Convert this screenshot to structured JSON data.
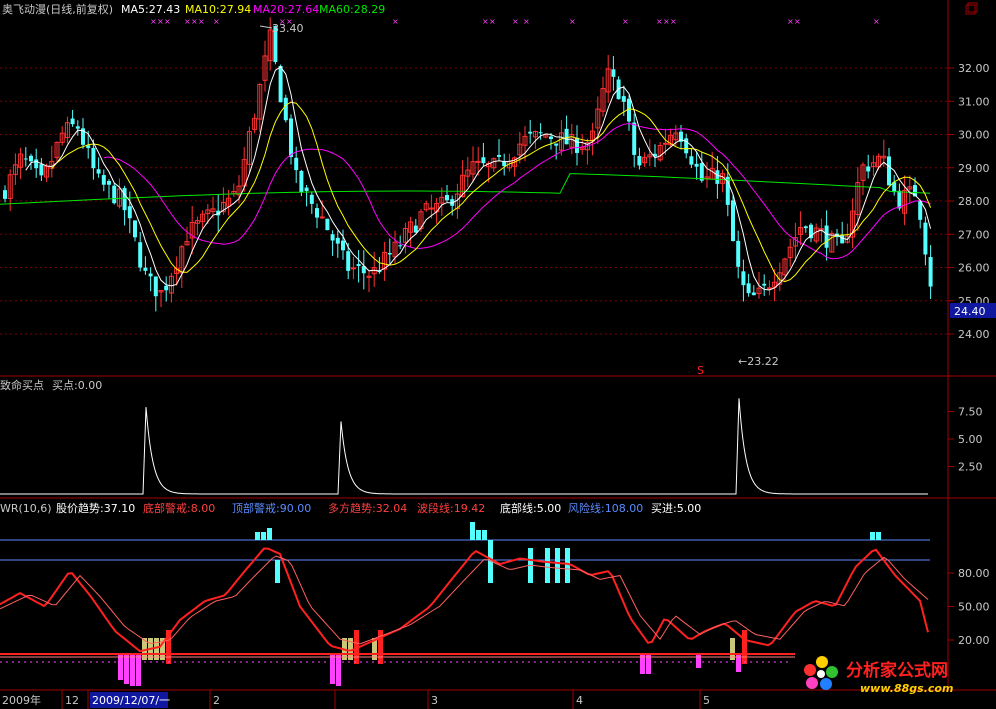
{
  "main_legend": {
    "stock": "奥飞动漫(日线,前复权)",
    "ma5": "MA5:27.43",
    "ma10": "MA10:27.94",
    "ma20": "MA20:27.64",
    "ma60": "MA60:28.29"
  },
  "main_axis": {
    "ticks": [
      "32.00",
      "31.00",
      "30.00",
      "29.00",
      "28.00",
      "27.00",
      "26.00",
      "25.00",
      "24.00"
    ],
    "tick_values": [
      32,
      31,
      30,
      29,
      28,
      27,
      26,
      25,
      24
    ],
    "current_price": "24.40",
    "high_label": "33.40",
    "low_label": "←23.22",
    "marker": "S"
  },
  "sub1_legend": {
    "title": "致命买点",
    "buy": "买点:0.00"
  },
  "sub1_axis": {
    "ticks": [
      "7.50",
      "5.00",
      "2.50"
    ],
    "tick_values": [
      7.5,
      5,
      2.5
    ]
  },
  "sub2_legend": {
    "wr": "WR(10,6)",
    "trend": "股价趋势:37.10",
    "bottom_warn": "底部警戒:8.00",
    "top_warn": "顶部警戒:90.00",
    "bull": "多方趋势:32.04",
    "wave": "波段线:19.42",
    "bottom_line": "底部线:5.00",
    "risk_line": "风险线:108.00",
    "buy_in": "买进:5.00"
  },
  "sub2_axis": {
    "ticks": [
      "80.00",
      "50.00",
      "20.00"
    ],
    "tick_values": [
      80,
      50,
      20
    ]
  },
  "date_axis": {
    "labels": [
      "2009年",
      "12",
      "2009/12/07/一",
      "2",
      "3",
      "4",
      "5"
    ]
  },
  "watermark": {
    "name": "分析家公式网",
    "url": "www.88gs.com"
  },
  "colors": {
    "up": "#ff3232",
    "down": "#54ffff",
    "ma5": "#ffffff",
    "ma10": "#ffff00",
    "ma20": "#ff00ff",
    "ma60": "#00e600",
    "axis_red": "#a00000",
    "wr_red": "#ff2020",
    "blue_line": "#5a8cff"
  }
}
